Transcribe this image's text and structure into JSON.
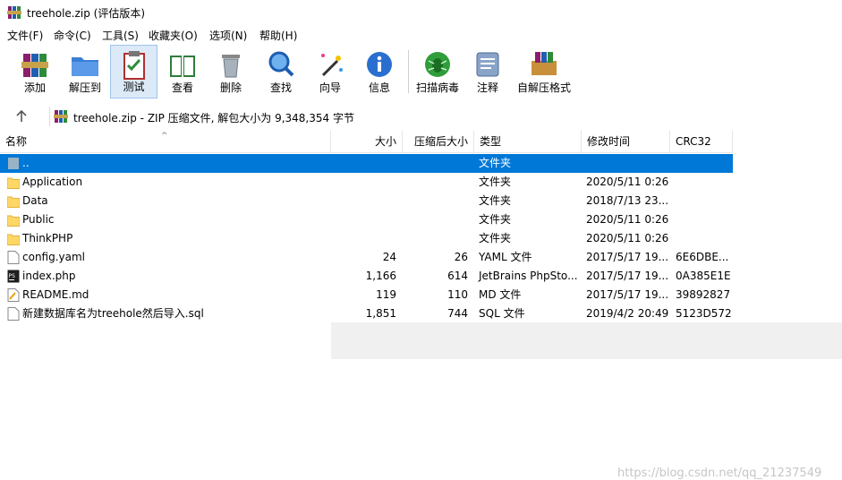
{
  "window": {
    "title": "treehole.zip (评估版本)"
  },
  "menu": [
    "文件(F)",
    "命令(C)",
    "工具(S)",
    "收藏夹(O)",
    "选项(N)",
    "帮助(H)"
  ],
  "toolbar": {
    "buttons": [
      {
        "label": "添加",
        "icon": "add-archive-icon"
      },
      {
        "label": "解压到",
        "icon": "extract-to-icon"
      },
      {
        "label": "测试",
        "icon": "test-icon"
      },
      {
        "label": "查看",
        "icon": "view-icon"
      },
      {
        "label": "删除",
        "icon": "delete-icon"
      },
      {
        "label": "查找",
        "icon": "find-icon"
      },
      {
        "label": "向导",
        "icon": "wizard-icon"
      },
      {
        "label": "信息",
        "icon": "info-icon"
      },
      {
        "label": "扫描病毒",
        "icon": "virus-scan-icon"
      },
      {
        "label": "注释",
        "icon": "comment-icon"
      },
      {
        "label": "自解压格式",
        "icon": "sfx-icon"
      }
    ],
    "active": "测试"
  },
  "address": {
    "path": "treehole.zip - ZIP 压缩文件, 解包大小为 9,348,354 字节"
  },
  "columns": [
    "名称",
    "大小",
    "压缩后大小",
    "类型",
    "修改时间",
    "CRC32"
  ],
  "files": [
    {
      "name": "..",
      "size": "",
      "packed": "",
      "type": "文件夹",
      "modified": "",
      "crc": "",
      "icon": "parent-folder-icon",
      "selected": true
    },
    {
      "name": "Application",
      "size": "",
      "packed": "",
      "type": "文件夹",
      "modified": "2020/5/11 0:26",
      "crc": "",
      "icon": "folder-icon"
    },
    {
      "name": "Data",
      "size": "",
      "packed": "",
      "type": "文件夹",
      "modified": "2018/7/13 23...",
      "crc": "",
      "icon": "folder-icon"
    },
    {
      "name": "Public",
      "size": "",
      "packed": "",
      "type": "文件夹",
      "modified": "2020/5/11 0:26",
      "crc": "",
      "icon": "folder-icon"
    },
    {
      "name": "ThinkPHP",
      "size": "",
      "packed": "",
      "type": "文件夹",
      "modified": "2020/5/11 0:26",
      "crc": "",
      "icon": "folder-icon"
    },
    {
      "name": "config.yaml",
      "size": "24",
      "packed": "26",
      "type": "YAML 文件",
      "modified": "2017/5/17 19...",
      "crc": "6E6DBE...",
      "icon": "file-icon"
    },
    {
      "name": "index.php",
      "size": "1,166",
      "packed": "614",
      "type": "JetBrains PhpSto...",
      "modified": "2017/5/17 19...",
      "crc": "0A385E1E",
      "icon": "phpstorm-file-icon"
    },
    {
      "name": "README.md",
      "size": "119",
      "packed": "110",
      "type": "MD 文件",
      "modified": "2017/5/17 19...",
      "crc": "39892827",
      "icon": "markdown-file-icon"
    },
    {
      "name": "新建数据库名为treehole然后导入.sql",
      "size": "1,851",
      "packed": "744",
      "type": "SQL 文件",
      "modified": "2019/4/2 20:49",
      "crc": "5123D572",
      "icon": "file-icon"
    }
  ],
  "watermark": "https://blog.csdn.net/qq_21237549"
}
